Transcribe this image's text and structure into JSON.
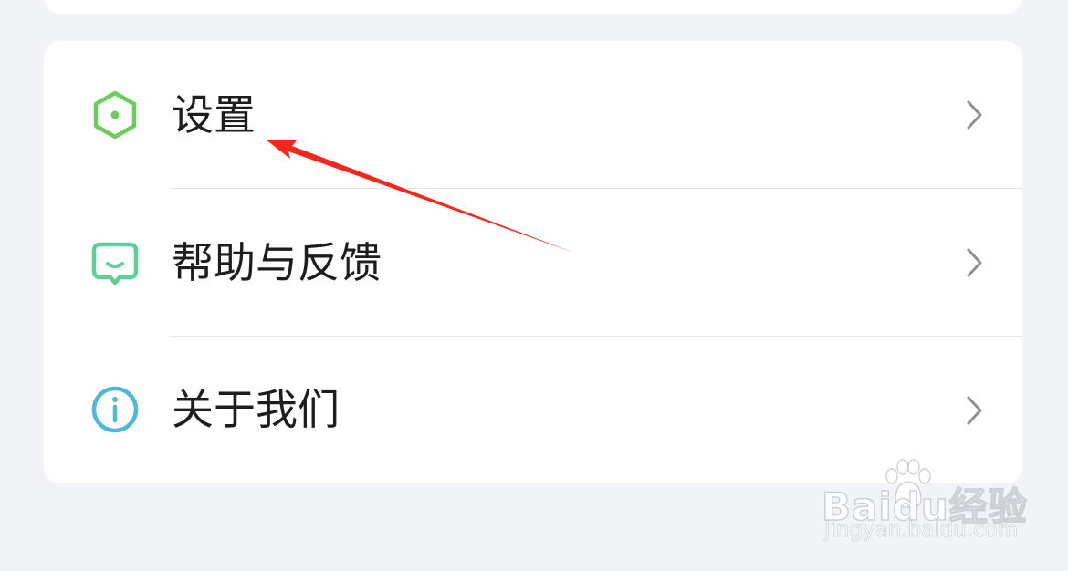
{
  "menu": {
    "items": [
      {
        "label": "设置",
        "icon": "settings-hexagon-icon",
        "color": "#6ccc5d"
      },
      {
        "label": "帮助与反馈",
        "icon": "feedback-bubble-icon",
        "color": "#5fcf9a"
      },
      {
        "label": "关于我们",
        "icon": "info-icon",
        "color": "#4fb8d6"
      }
    ]
  },
  "annotation": {
    "color": "#f2281e"
  },
  "watermark": {
    "brand": "Baidu经验",
    "url": "jingyan.baidu.com"
  }
}
